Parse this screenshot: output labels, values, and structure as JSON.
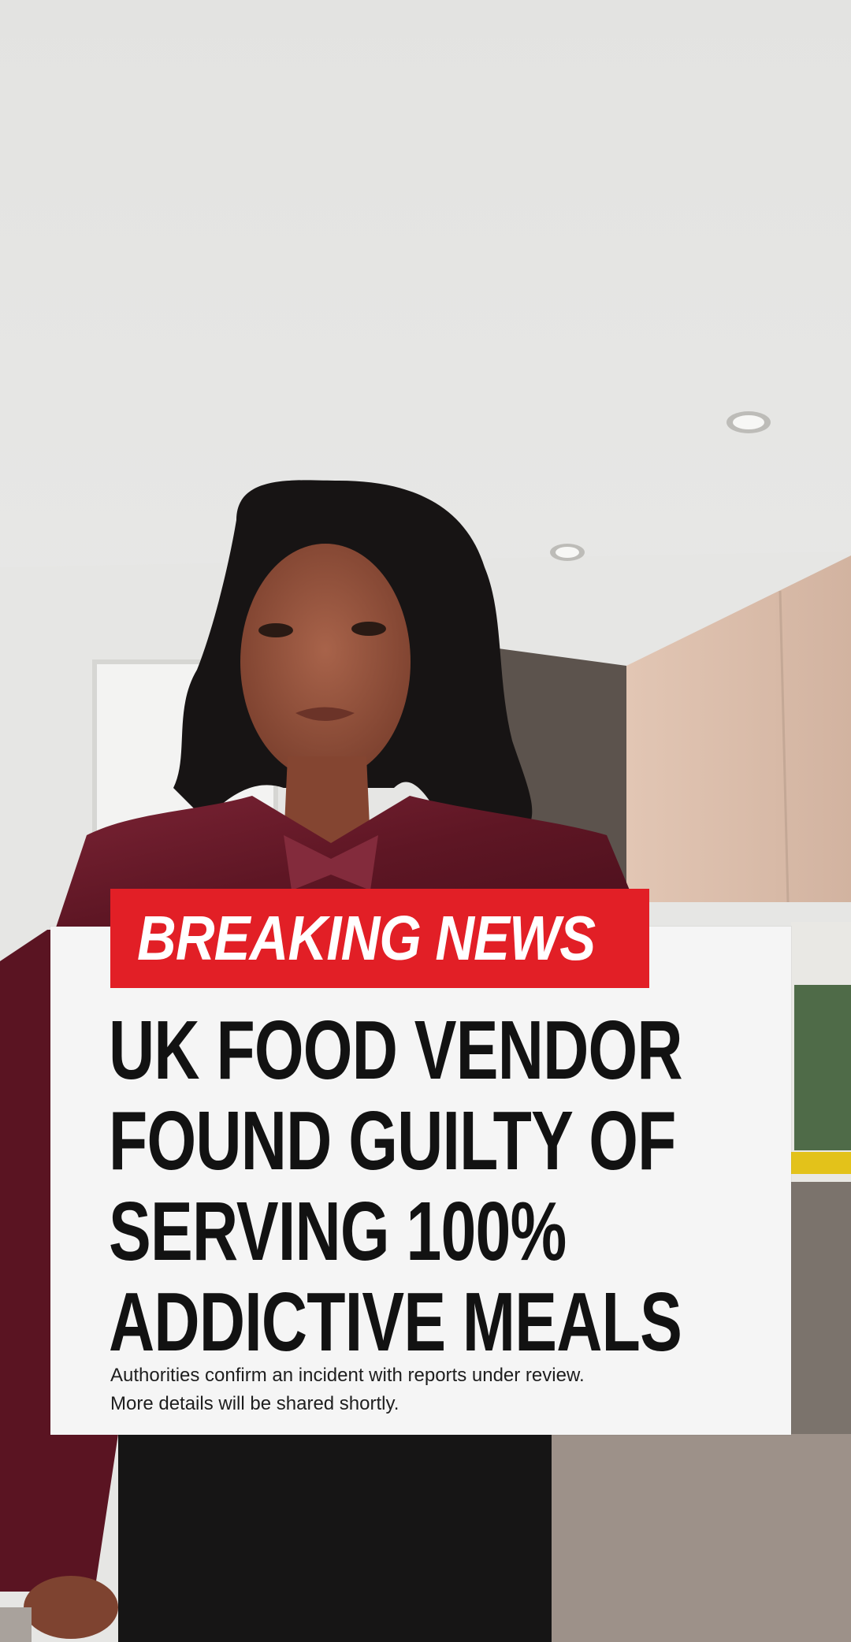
{
  "overlay": {
    "banner": "BREAKING NEWS",
    "headline_lines": [
      "UK FOOD VENDOR",
      "FOUND GUILTY OF",
      "SERVING 100%",
      "ADDICTIVE MEALS"
    ],
    "subtext_lines": [
      "Authorities confirm an incident with reports under review.",
      "More details will be shared shortly."
    ]
  },
  "colors": {
    "banner_red": "#e21f26",
    "card_white": "#f5f5f5",
    "headline_black": "#121212",
    "blouse_burgundy": "#6b1a2a",
    "cabinet_beige": "#d9bfae"
  }
}
